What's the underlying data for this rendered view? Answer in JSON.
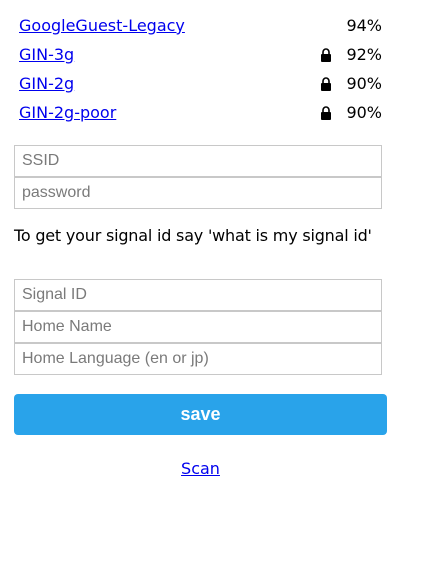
{
  "networks": [
    {
      "ssid": "GoogleGuest-Legacy",
      "strength": "94%",
      "locked": false
    },
    {
      "ssid": "GIN-3g",
      "strength": "92%",
      "locked": true
    },
    {
      "ssid": "GIN-2g",
      "strength": "90%",
      "locked": true
    },
    {
      "ssid": "GIN-2g-poor",
      "strength": "90%",
      "locked": true
    }
  ],
  "wifi_form": {
    "ssid_placeholder": "SSID",
    "password_placeholder": "password"
  },
  "hint_text": "To get your signal id say 'what is my signal id'",
  "home_form": {
    "signal_id_placeholder": "Signal ID",
    "home_name_placeholder": "Home Name",
    "home_language_placeholder": "Home Language (en or jp)"
  },
  "save_label": "save",
  "scan_label": "Scan",
  "colors": {
    "link": "#0000ee",
    "button": "#29a3ea",
    "button_text": "#ffffff"
  },
  "icons": {
    "lock": "lock-icon"
  }
}
